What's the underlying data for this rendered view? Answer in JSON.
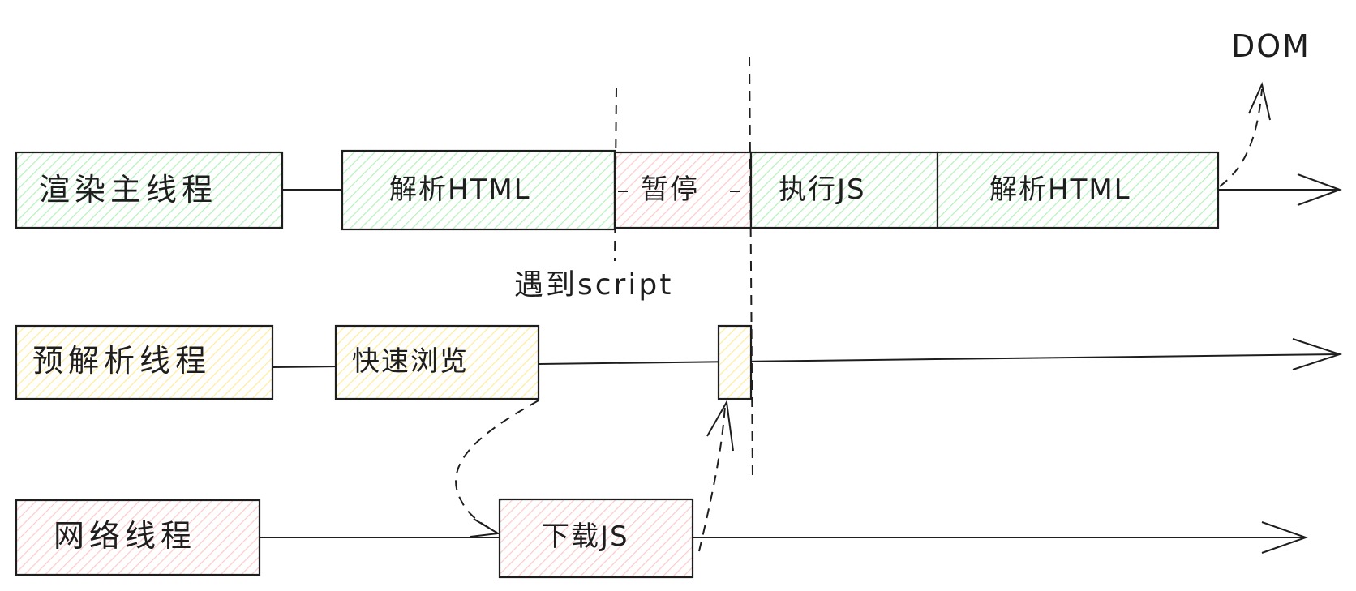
{
  "colors": {
    "stroke": "#1e1e1e",
    "green_fill": "#b2f2bb",
    "pink_fill": "#ffc9c9",
    "yellow_fill": "#ffec99"
  },
  "threads": {
    "main": {
      "label": "渲染主线程",
      "blocks": [
        "解析HTML",
        "暂停",
        "执行JS",
        "解析HTML"
      ]
    },
    "preparse": {
      "label": "预解析线程",
      "blocks": [
        "快速浏览"
      ]
    },
    "network": {
      "label": "网络线程",
      "blocks": [
        "下载JS"
      ]
    }
  },
  "annotations": {
    "dom": "DOM",
    "script_encounter": "遇到script"
  }
}
